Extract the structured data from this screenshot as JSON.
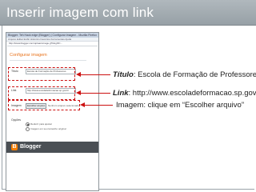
{
  "slide": {
    "title": "Inserir imagem com link"
  },
  "screenshot": {
    "window_title": "Blogger: Teh Hack edge (Blogger) | Configurar imagem - Mozilla Firefox",
    "menu": "Arquivo  Editar  Exibir  Histórico  Favoritos  Ferramentas  Ajuda",
    "address": "http://www.blogger.com/upload-image.g?blogID=...",
    "dialog_heading": "Configurar imagem",
    "fields": {
      "title_label": "Título",
      "title_value": "Escola de Formação de Professores",
      "link_label": "Link",
      "link_value": "http://www.escoladeformacao.sp.gov.br",
      "image_label": "Imagem",
      "choose_button": "Escolher arquivo",
      "no_file": "Nenhum arquivo selecionado"
    },
    "options_label": "Opções",
    "options": [
      "Reduzir para ajustar",
      "Imagem em seu tamanho original"
    ],
    "brand": "Blogger",
    "brand_letter": "B"
  },
  "captions": {
    "title_term": "Título",
    "title_rest": ": Escola de Formação de Professores.",
    "link_term": "Link",
    "link_rest": ": http://www.escoladeformacao.sp.gov.br",
    "image_text": "Imagem: clique em “Escolher arquivo”"
  },
  "colors": {
    "header": "#a3acb2",
    "accent_red": "#cc1111",
    "dialog_heading": "#e8731c",
    "blogger_orange": "#f57d00"
  }
}
